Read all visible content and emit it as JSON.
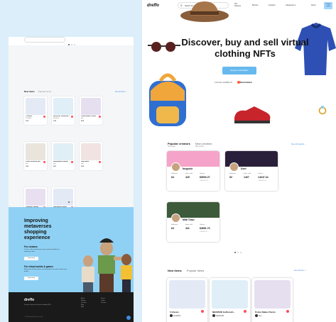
{
  "colors": {
    "accent": "#3f8de0",
    "button": "#66b9ee",
    "promo": "#8fd1f4",
    "footer": "#1a1a1a",
    "fav": "#ff4d5a"
  },
  "mobile": {
    "tabs": {
      "active": "New items",
      "inactive": "Popular items"
    },
    "see_all": "See all items →",
    "items": [
      {
        "name": "5 Ghosts",
        "creator": "PunkRKA",
        "price": "1.05"
      },
      {
        "name": "NEOROID GoDrench...",
        "creator": "NEOROID",
        "price": "1.05"
      },
      {
        "name": "Potion Maker Pemio",
        "creator": "Hey",
        "price": "0.62"
      },
      {
        "name": "Punks Whitelist #42",
        "creator": "Hop",
        "price": "1.05"
      },
      {
        "name": "Moonwalker Hoodie",
        "creator": "Hop",
        "price": "0.01"
      },
      {
        "name": "Dino Mask",
        "creator": "Hop",
        "price": "1.05"
      },
      {
        "name": "Character Hoodie",
        "creator": "Lamia Studios",
        "price": "1.05"
      },
      {
        "name": "Soulshearer Mage",
        "creator": "Lamia",
        "price": "1.05"
      }
    ],
    "promo": {
      "title": "Improving metaverses shopping experience",
      "creators_title": "For creators",
      "creators_desc": "Create, sell and showcase your virtual wearables to metaverse fans.",
      "creators_btn": "Learn more",
      "brands_title": "For virtual worlds & games",
      "brands_desc": "Bring more fashion items and wearables into your world using dreffo.",
      "brands_btn": "Learn more"
    },
    "footer": {
      "logo": "dreffo",
      "tagline": "Discover, buy and sell virtual clothing NFTs",
      "col1": [
        "About",
        "Explore",
        "Creators",
        "Blog",
        "FAQ"
      ],
      "col2": [
        "Social",
        "Twitter",
        "Discord"
      ],
      "copyright": "© 2022 dreffo. All rights reserved"
    }
  },
  "desktop": {
    "logo": "dreffo",
    "search_placeholder": "Search for creators & wearables",
    "nav": [
      "Hot features",
      "Browse",
      "Creators",
      "Categories ▾",
      "About"
    ],
    "connect": "Connect wallet",
    "headline": "Discover, buy and sell virtual clothing NFTs",
    "explore_button": "Explore wearables",
    "available_on": "Currently available for",
    "platform": "Decentraland",
    "creators_section": {
      "tab_active": "Popular creators",
      "tab_active_sub": "This week",
      "tab_inactive": "New creators",
      "tab_inactive_sub": "This month",
      "see_all": "See all creators →"
    },
    "creators": [
      {
        "name": "fungoolz",
        "followers": "64",
        "items": "425",
        "volume": "$5500.27",
        "usd": "≈ $10,307.73",
        "banner": "#f5a3c9"
      },
      {
        "name": "Doni",
        "followers": "52",
        "items": "1407",
        "volume": "14047.24",
        "usd": "≈ $14,047.24",
        "banner": "#2a1f3a"
      },
      {
        "name": "Mitti Toski",
        "followers": "64",
        "items": "431",
        "volume": "$3851.73",
        "usd": "≈ $6,920.43",
        "banner": "#3d5a3a"
      }
    ],
    "creator_labels": {
      "followers": "Followers",
      "items": "Items sold",
      "volume": "Volume"
    },
    "items_section": {
      "tab_active": "New items",
      "tab_inactive": "Popular items",
      "see_all": "See all items →"
    },
    "items": [
      {
        "name": "5 Ghosts",
        "creator": "PunkRKA"
      },
      {
        "name": "NEOROID GoDrench...",
        "creator": "NEOROID"
      },
      {
        "name": "Potion Maker Pemio",
        "creator": "Hey"
      }
    ]
  }
}
